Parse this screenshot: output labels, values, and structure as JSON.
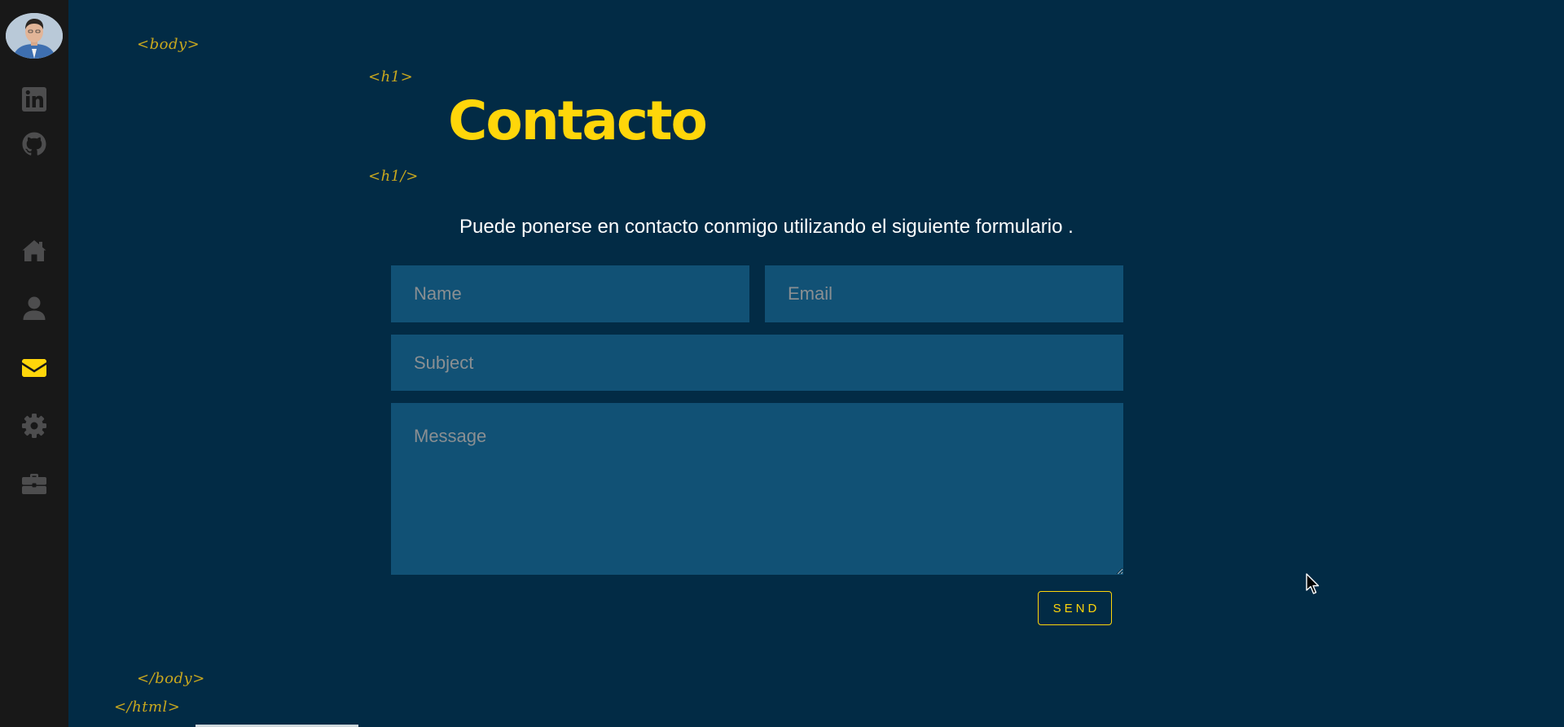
{
  "sidebar": {
    "icons": [
      "avatar",
      "linkedin-icon",
      "github-icon",
      "home-icon",
      "user-icon",
      "envelope-icon",
      "gear-icon",
      "briefcase-icon"
    ],
    "active_color": "#ffd60a",
    "inactive_color": "#4d4d4e"
  },
  "tags": {
    "body_open": "<body>",
    "h1_open": "<h1>",
    "h1_close": "<h1/>",
    "body_close": "</body>",
    "html_close": "</html>"
  },
  "page": {
    "title": "Contacto",
    "intro": "Puede ponerse en contacto conmigo utilizando el siguiente formulario ."
  },
  "form": {
    "name_placeholder": "Name",
    "email_placeholder": "Email",
    "subject_placeholder": "Subject",
    "message_placeholder": "Message",
    "send_label": "SEND"
  },
  "colors": {
    "background": "#022b45",
    "sidebar": "#181818",
    "accent": "#ffd60a",
    "field": "#115175"
  }
}
